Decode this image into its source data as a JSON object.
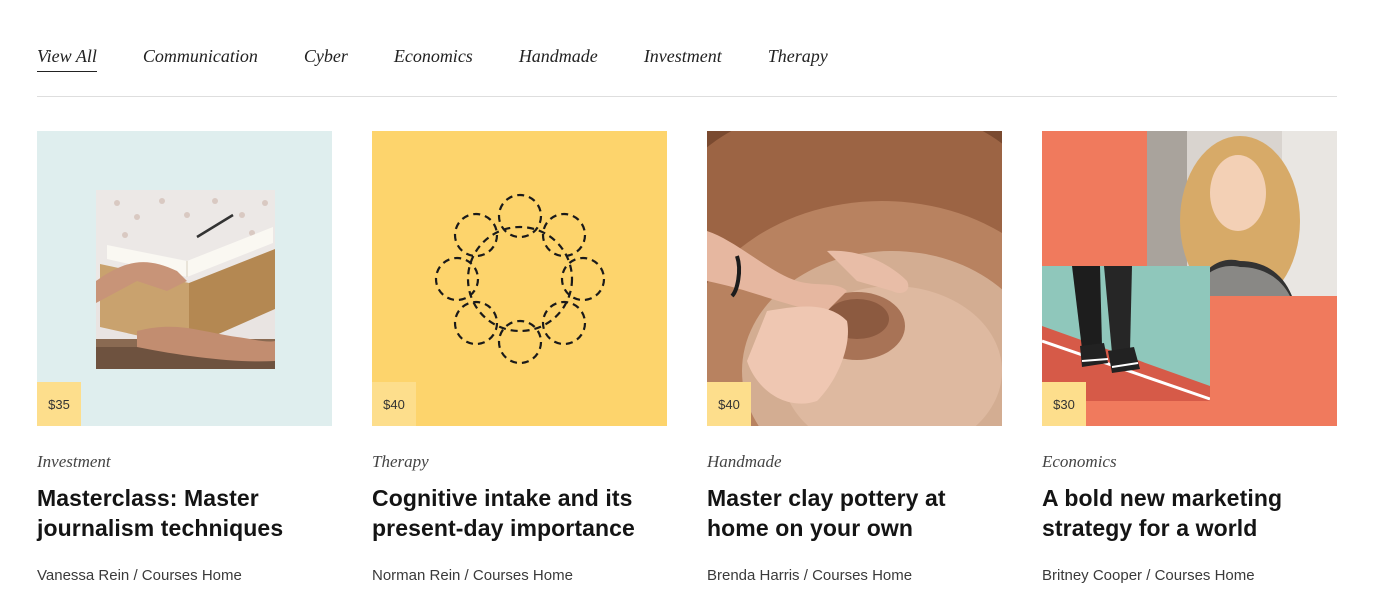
{
  "tabs": [
    {
      "label": "View All",
      "active": true
    },
    {
      "label": "Communication"
    },
    {
      "label": "Cyber"
    },
    {
      "label": "Economics"
    },
    {
      "label": "Handmade"
    },
    {
      "label": "Investment"
    },
    {
      "label": "Therapy"
    }
  ],
  "courses": [
    {
      "price": "$35",
      "category": "Investment",
      "title": "Masterclass: Master journalism techniques",
      "author": "Vanessa Rein",
      "separator": " / ",
      "section": "Courses Home",
      "image": "journal-writing-photo"
    },
    {
      "price": "$40",
      "category": "Therapy",
      "title": "Cognitive intake and its present-day importance",
      "author": "Norman Rein",
      "separator": " / ",
      "section": "Courses Home",
      "image": "dashed-flower-illustration"
    },
    {
      "price": "$40",
      "category": "Handmade",
      "title": "Master clay pottery at home on your own",
      "author": "Brenda Harris",
      "separator": " / ",
      "section": "Courses Home",
      "image": "pottery-wheel-photo"
    },
    {
      "price": "$30",
      "category": "Economics",
      "title": "A bold new marketing strategy for a world",
      "author": "Britney Cooper",
      "separator": " / ",
      "section": "Courses Home",
      "image": "woman-collage-photo"
    }
  ],
  "colors": {
    "mint": "#dfeeee",
    "yellow": "#fdd46c",
    "coral": "#f07a5d",
    "price_badge": "#fdde8c",
    "clay": "#b88260"
  }
}
